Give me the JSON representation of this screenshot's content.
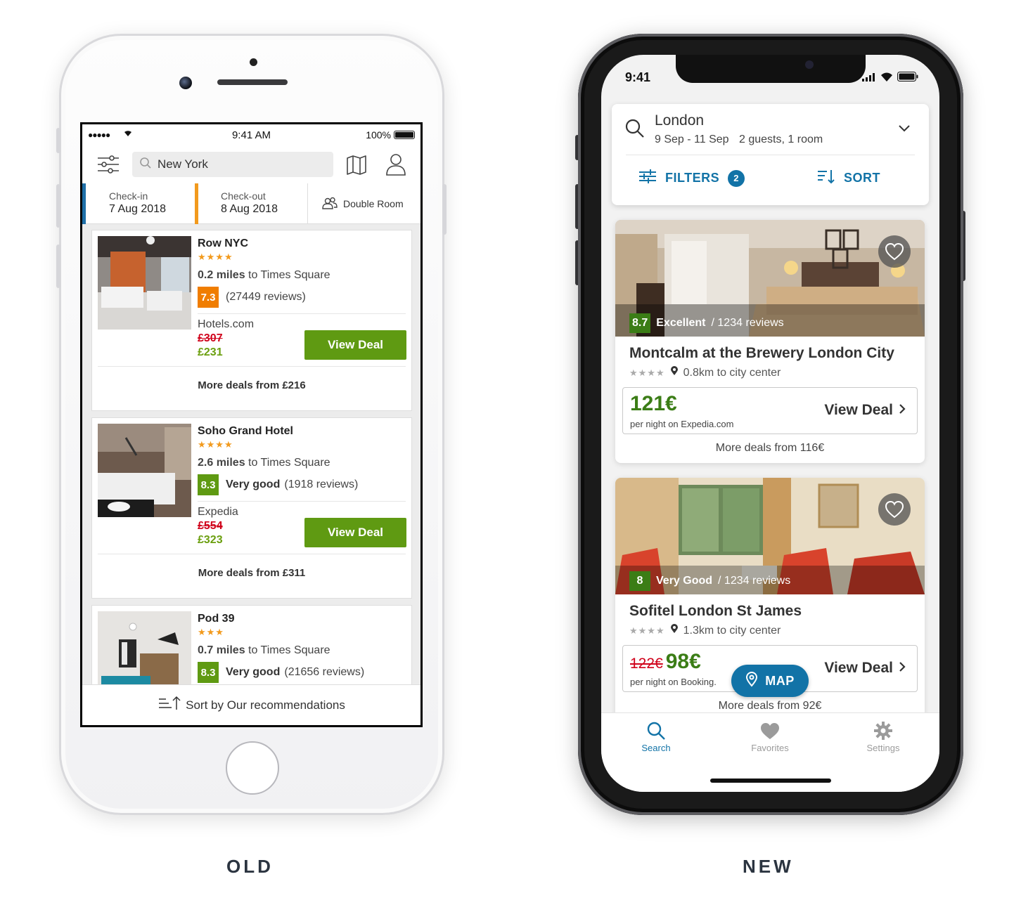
{
  "labels": {
    "old": "OLD",
    "new": "NEW"
  },
  "old_app": {
    "status": {
      "signal": "●●●●● ",
      "time": "9:41 AM",
      "battery": "100%"
    },
    "search": {
      "value": "New York"
    },
    "dates": {
      "checkin_label": "Check-in",
      "checkin_value": "7 Aug 2018",
      "checkout_label": "Check-out",
      "checkout_value": "8 Aug 2018",
      "room": "Double Room"
    },
    "hotels": [
      {
        "name": "Row NYC",
        "stars": "★★★★",
        "distance": "0.2 miles",
        "distance_to": " to Times Square",
        "rating": "7.3",
        "rating_color": "#f07d00",
        "rating_text": "",
        "reviews": "(27449 reviews)",
        "provider": "Hotels.com",
        "old_price": "£307",
        "price": "£231",
        "cta": "View Deal",
        "more": "More deals from £216"
      },
      {
        "name": "Soho Grand Hotel",
        "stars": "★★★★",
        "distance": "2.6 miles",
        "distance_to": " to Times Square",
        "rating": "8.3",
        "rating_color": "#5f9a12",
        "rating_text": "Very good",
        "reviews": "(1918 reviews)",
        "provider": "Expedia",
        "old_price": "£554",
        "price": "£323",
        "cta": "View Deal",
        "more": "More deals from £311"
      },
      {
        "name": "Pod 39",
        "stars": "★★★",
        "distance": "0.7 miles",
        "distance_to": " to Times Square",
        "rating": "8.3",
        "rating_color": "#5f9a12",
        "rating_text": "Very good",
        "reviews": "(21656 reviews)"
      }
    ],
    "sort_label": "Sort by Our recommendations"
  },
  "new_app": {
    "status": {
      "time": "9:41"
    },
    "search": {
      "location": "London",
      "dates": "9 Sep - 11 Sep",
      "guests": "2 guests, 1 room"
    },
    "filters": {
      "label": "FILTERS",
      "count": "2"
    },
    "sort": {
      "label": "SORT"
    },
    "hotels": [
      {
        "score": "8.7",
        "score_word": "Excellent",
        "reviews": "/ 1234 reviews",
        "name": "Montcalm at the Brewery London City",
        "stars": "★★★★",
        "distance": "0.8km to city center",
        "old_price": "",
        "price": "121€",
        "per_night": "per night on Expedia.com",
        "cta": "View Deal",
        "more": "More deals from 116€"
      },
      {
        "score": "8",
        "score_word": "Very Good",
        "reviews": "/ 1234 reviews",
        "name": "Sofitel London St James",
        "stars": "★★★★",
        "distance": "1.3km to city center",
        "old_price": "122€",
        "price": "98€",
        "per_night": "per night on Booking.",
        "cta": "View Deal",
        "more": "More deals from 92€"
      }
    ],
    "map_button": "MAP",
    "tabs": [
      {
        "label": "Search",
        "icon": "search-icon"
      },
      {
        "label": "Favorites",
        "icon": "heart-icon"
      },
      {
        "label": "Settings",
        "icon": "gear-icon"
      }
    ],
    "accent_color": "#1273a7"
  }
}
